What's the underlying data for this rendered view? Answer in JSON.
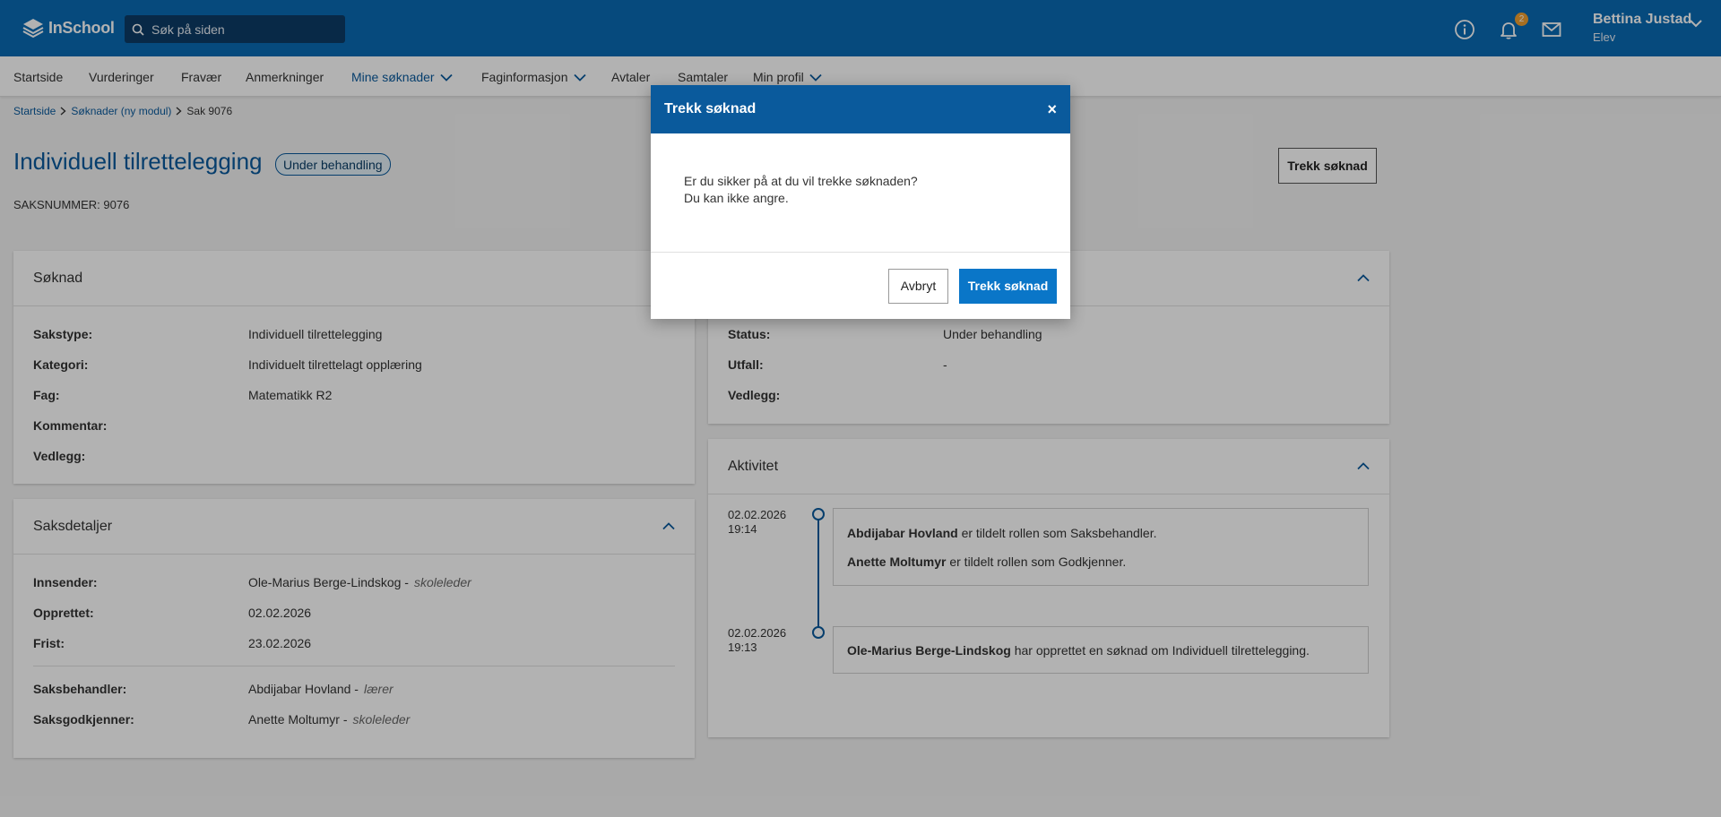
{
  "app": {
    "name": "InSchool"
  },
  "header": {
    "search_placeholder": "Søk på siden",
    "notification_count": "2",
    "user_name": "Bettina Justad",
    "user_role": "Elev"
  },
  "nav": {
    "items": [
      {
        "label": "Startside"
      },
      {
        "label": "Vurderinger"
      },
      {
        "label": "Fravær"
      },
      {
        "label": "Anmerkninger"
      },
      {
        "label": "Mine søknader"
      },
      {
        "label": "Faginformasjon"
      },
      {
        "label": "Avtaler"
      },
      {
        "label": "Samtaler"
      },
      {
        "label": "Min profil"
      }
    ]
  },
  "breadcrumb": [
    "Startside",
    "Søknader (ny modul)",
    "Sak 9076"
  ],
  "page": {
    "title": "Individuell tilrettelegging",
    "status": "Under behandling",
    "saksnummer": "SAKSNUMMER: 9076",
    "withdraw_label": "Trekk søknad"
  },
  "soknad": {
    "title": "Søknad",
    "rows": [
      {
        "label": "Sakstype:",
        "value": "Individuell tilrettelegging"
      },
      {
        "label": "Kategori:",
        "value": "Individuelt tilrettelagt opplæring"
      },
      {
        "label": "Fag:",
        "value": "Matematikk R2"
      },
      {
        "label": "Kommentar:",
        "value": ""
      },
      {
        "label": "Vedlegg:",
        "value": ""
      }
    ]
  },
  "saksdetaljer": {
    "title": "Saksdetaljer",
    "rows": [
      {
        "label": "Innsender:",
        "value": "Ole-Marius Berge-Lindskog -",
        "role": "skoleleder"
      },
      {
        "label": "Opprettet:",
        "value": "02.02.2026",
        "role": ""
      },
      {
        "label": "Frist:",
        "value": "23.02.2026",
        "role": ""
      }
    ],
    "rows2": [
      {
        "label": "Saksbehandler:",
        "value": "Abdijabar Hovland -",
        "role": "lærer"
      },
      {
        "label": "Saksgodkjenner:",
        "value": "Anette Moltumyr -",
        "role": "skoleleder"
      }
    ]
  },
  "status_card": {
    "rows": [
      {
        "label": "Status:",
        "value": "Under behandling"
      },
      {
        "label": "Utfall:",
        "value": "-"
      },
      {
        "label": "Vedlegg:",
        "value": ""
      }
    ]
  },
  "aktivitet": {
    "title": "Aktivitet",
    "entries": [
      {
        "date": "02.02.2026",
        "time": "19:14",
        "lines": [
          {
            "name": "Abdijabar Hovland",
            "text": "er tildelt rollen som Saksbehandler."
          },
          {
            "name": "Anette Moltumyr",
            "text": "er tildelt rollen som Godkjenner."
          }
        ]
      },
      {
        "date": "02.02.2026",
        "time": "19:13",
        "lines": [
          {
            "name": "Ole-Marius Berge-Lindskog",
            "text": "har opprettet en søknad om Individuell tilrettelegging."
          }
        ]
      }
    ]
  },
  "modal": {
    "title": "Trekk søknad",
    "close": "×",
    "line1": "Er du sikker på at du vil trekke søknaden?",
    "line2": "Du kan ikke angre.",
    "cancel_label": "Avbryt",
    "confirm_label": "Trekk søknad"
  },
  "colors": {
    "topbar": "#0a6ab4",
    "accent": "#0a5a9c",
    "primary_button": "#0a76c8",
    "badge": "#f0a030"
  }
}
